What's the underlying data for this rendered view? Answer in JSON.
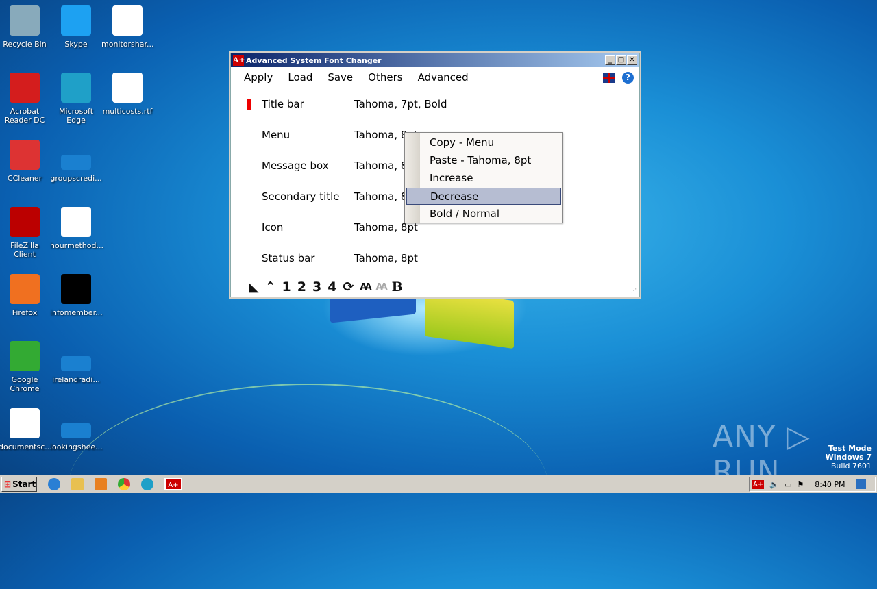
{
  "desktop": {
    "icons": [
      {
        "label": "Recycle Bin",
        "icon": "recycle-bin-icon",
        "color": "#8ab"
      },
      {
        "label": "Skype",
        "icon": "skype-icon",
        "color": "#1da1f2"
      },
      {
        "label": "monitorshar...",
        "icon": "word-doc-icon",
        "color": "#fff"
      },
      {
        "label": "Acrobat Reader DC",
        "icon": "acrobat-icon",
        "color": "#d41d1d"
      },
      {
        "label": "Microsoft Edge",
        "icon": "edge-icon",
        "color": "#1fa0c8"
      },
      {
        "label": "multicosts.rtf",
        "icon": "word-doc-icon",
        "color": "#fff"
      },
      {
        "label": "CCleaner",
        "icon": "ccleaner-icon",
        "color": "#d33"
      },
      {
        "label": "groupscredi...",
        "icon": "blank-file-icon",
        "color": "#1a80d0"
      },
      {
        "label": "FileZilla Client",
        "icon": "filezilla-icon",
        "color": "#b00"
      },
      {
        "label": "hourmethod...",
        "icon": "word-doc-icon",
        "color": "#fff"
      },
      {
        "label": "Firefox",
        "icon": "firefox-icon",
        "color": "#f07020"
      },
      {
        "label": "infomember...",
        "icon": "black-file-icon",
        "color": "#000"
      },
      {
        "label": "Google Chrome",
        "icon": "chrome-icon",
        "color": "#3a3"
      },
      {
        "label": "irelandradi...",
        "icon": "blank-file-icon",
        "color": "#1a80d0"
      },
      {
        "label": "documentsc...",
        "icon": "word-doc-icon",
        "color": "#fff"
      },
      {
        "label": "lookingshee...",
        "icon": "blank-file-icon",
        "color": "#1a80d0"
      }
    ]
  },
  "window": {
    "title": "Advanced System Font Changer",
    "app_icon": "A+",
    "menu": [
      "Apply",
      "Load",
      "Save",
      "Others",
      "Advanced"
    ],
    "rows": [
      {
        "name": "Title bar",
        "value": "Tahoma, 7pt, Bold"
      },
      {
        "name": "Menu",
        "value": "Tahoma, 8pt"
      },
      {
        "name": "Message box",
        "value": "Tahoma, 8pt"
      },
      {
        "name": "Secondary title",
        "value": "Tahoma, 8pt"
      },
      {
        "name": "Icon",
        "value": "Tahoma, 8pt"
      },
      {
        "name": "Status bar",
        "value": "Tahoma, 8pt"
      }
    ],
    "toolbar": [
      "◣",
      "⌃",
      "1",
      "2",
      "3",
      "4",
      "⟳",
      "AA",
      "AA",
      "B"
    ]
  },
  "context_menu": {
    "items": [
      "Copy - Menu",
      "Paste - Tahoma, 8pt",
      "Increase",
      "Decrease",
      "Bold / Normal"
    ],
    "selected": "Decrease"
  },
  "taskbar": {
    "start": "Start",
    "clock": "8:40 PM"
  },
  "watermark": {
    "brand": "ANY ▷ RUN",
    "line1": "Test Mode",
    "line2": "Windows 7",
    "line3": "Build 7601"
  }
}
